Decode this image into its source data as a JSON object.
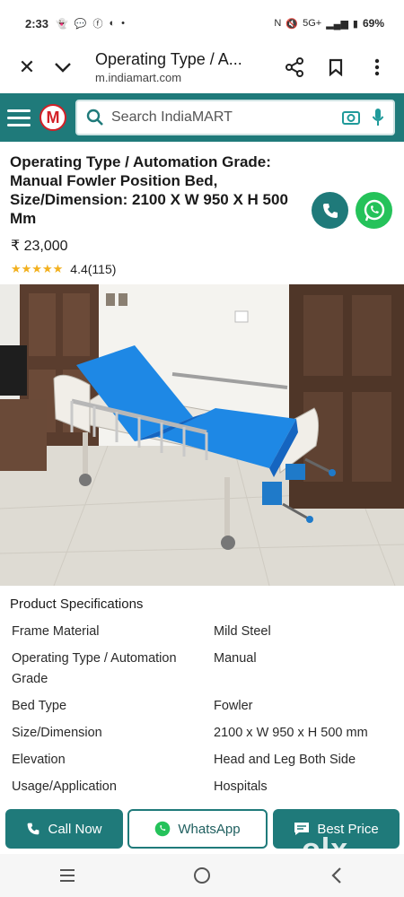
{
  "status": {
    "time": "2:33",
    "network": "5G+",
    "battery": "69%"
  },
  "browser": {
    "title": "Operating Type / A...",
    "url": "m.indiamart.com"
  },
  "header": {
    "search_placeholder": "Search IndiaMART"
  },
  "product": {
    "title": "Operating Type / Automation Grade: Manual Fowler Position Bed, Size/Dimension: 2100 X W 950 X H 500 Mm",
    "price": "₹ 23,000",
    "rating": "4.4(115)",
    "stars": "★★★★★"
  },
  "specs": {
    "heading": "Product Specifications",
    "rows": [
      {
        "k": "Frame Material",
        "v": "Mild Steel"
      },
      {
        "k": "Operating Type / Automation Grade",
        "v": "Manual"
      },
      {
        "k": "Bed Type",
        "v": "Fowler"
      },
      {
        "k": "Size/Dimension",
        "v": "2100 x W 950 x H 500 mm"
      },
      {
        "k": "Elevation",
        "v": "Head and Leg Both Side"
      },
      {
        "k": "Usage/Application",
        "v": "Hospitals"
      }
    ]
  },
  "actions": {
    "call": "Call Now",
    "whatsapp": "WhatsApp",
    "best_price": "Best Price"
  },
  "watermark": "olx",
  "colors": {
    "brand_teal": "#1f7a7a",
    "whatsapp_green": "#25c25a",
    "star": "#f2b01e"
  }
}
